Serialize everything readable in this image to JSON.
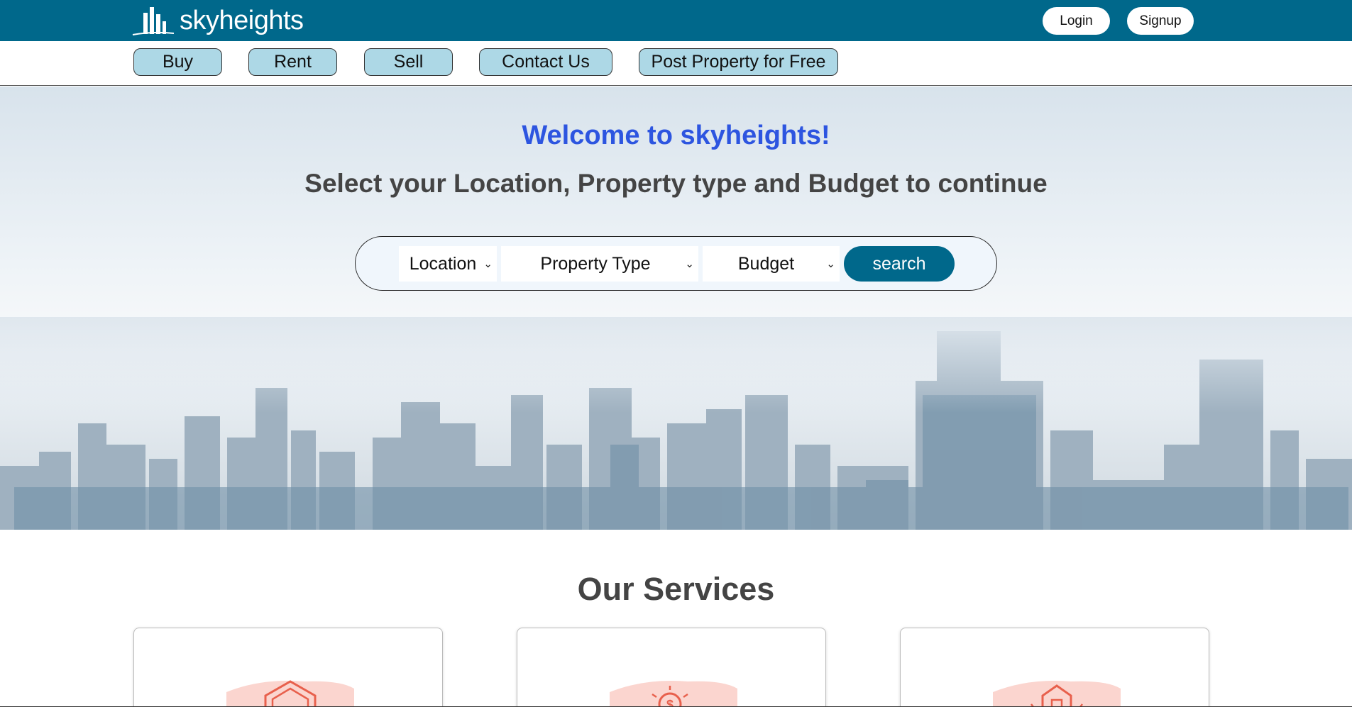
{
  "brand": {
    "name": "skyheights",
    "primary_color": "#00688b",
    "nav_color": "#add8e6",
    "welcome_color": "#2d55e0"
  },
  "header": {
    "login_label": "Login",
    "signup_label": "Signup"
  },
  "nav": {
    "items": [
      "Buy",
      "Rent",
      "Sell",
      "Contact Us",
      "Post Property for Free"
    ]
  },
  "hero": {
    "welcome": "Welcome to skyheights!",
    "subtitle": "Select your Location, Property type and Budget to continue"
  },
  "search": {
    "location": "Location",
    "property_type": "Property Type",
    "budget": "Budget",
    "button_label": "search"
  },
  "services": {
    "title": "Our Services",
    "cards": [
      {
        "icon": "house-icon"
      },
      {
        "icon": "dollar-icon"
      },
      {
        "icon": "home-window-icon"
      }
    ]
  }
}
